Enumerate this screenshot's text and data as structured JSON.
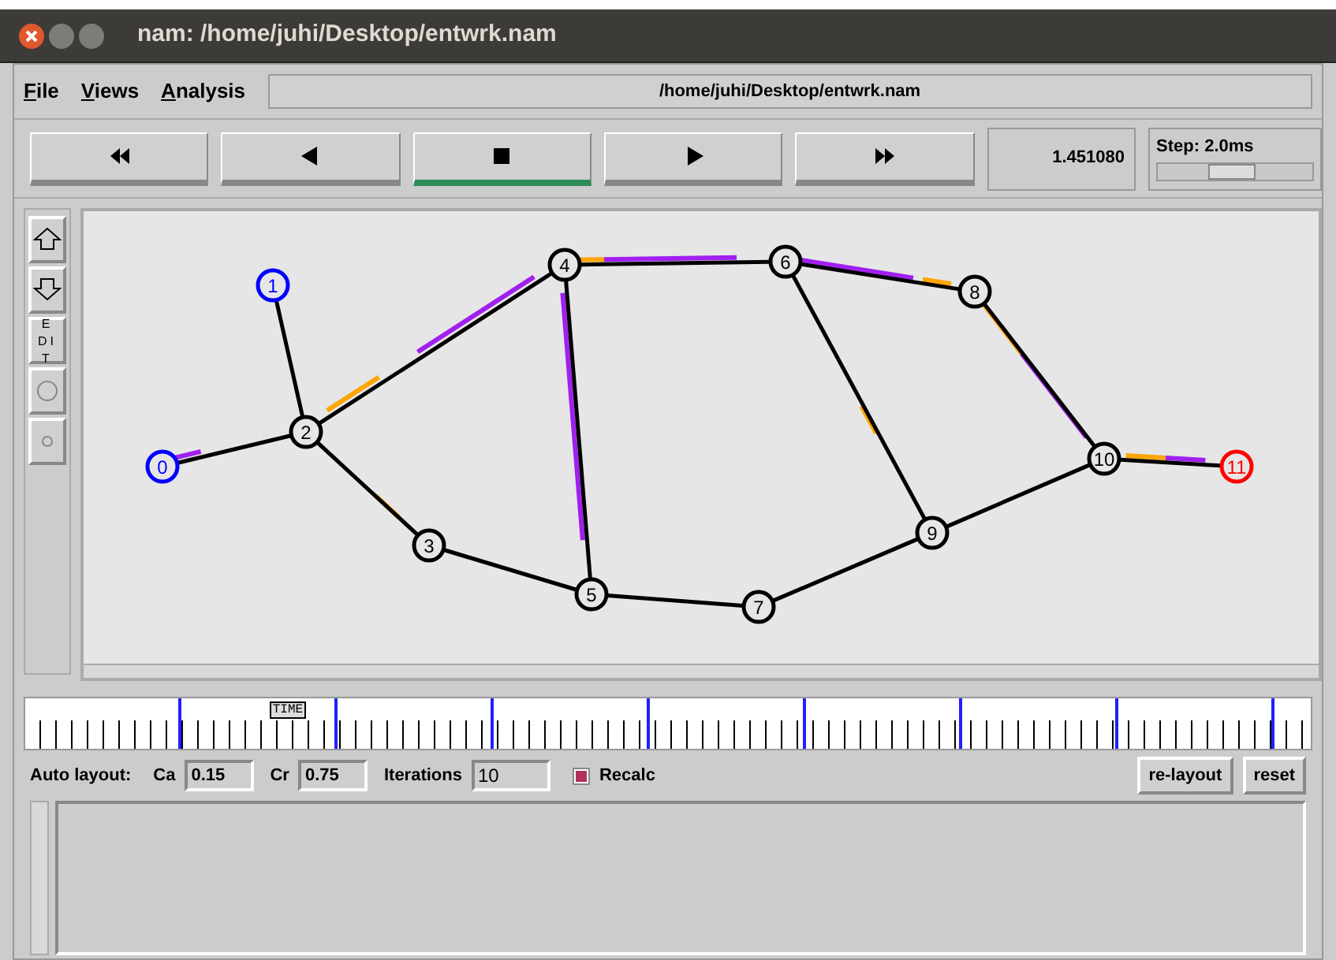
{
  "window": {
    "title": "nam: /home/juhi/Desktop/entwrk.nam"
  },
  "menu": [
    {
      "label": "File"
    },
    {
      "label": "Views"
    },
    {
      "label": "Analysis"
    }
  ],
  "file_path": "/home/juhi/Desktop/entwrk.nam",
  "playback_buttons": [
    {
      "kind": "fast-rewind",
      "selected": false
    },
    {
      "kind": "rewind",
      "selected": false
    },
    {
      "kind": "stop",
      "selected": true
    },
    {
      "kind": "play",
      "selected": false
    },
    {
      "kind": "fast-forward",
      "selected": false
    }
  ],
  "time": "1.451080",
  "step": {
    "label": "Step: 2.0ms",
    "level": 0.45
  },
  "tools": [
    {
      "kind": "zoom-in"
    },
    {
      "kind": "zoom-out"
    },
    {
      "kind": "edit",
      "label": "EDIT"
    },
    {
      "kind": "large-circle"
    },
    {
      "kind": "small-circle"
    }
  ],
  "nodes": [
    {
      "label": "0",
      "color": "#0000ff"
    },
    {
      "label": "1",
      "color": "#0000ff"
    },
    {
      "label": "2",
      "color": "#000000"
    },
    {
      "label": "3",
      "color": "#000000"
    },
    {
      "label": "4",
      "color": "#000000"
    },
    {
      "label": "5",
      "color": "#000000"
    },
    {
      "label": "6",
      "color": "#000000"
    },
    {
      "label": "7",
      "color": "#000000"
    },
    {
      "label": "8",
      "color": "#000000"
    },
    {
      "label": "9",
      "color": "#000000"
    },
    {
      "label": "10",
      "color": "#000000"
    },
    {
      "label": "11",
      "color": "#ff0000"
    }
  ],
  "timeline": {
    "marker": "TIME",
    "level": 0.19
  },
  "auto_layout": {
    "label": "Auto layout:",
    "fields": [
      {
        "label": "Ca",
        "value": "0.15"
      },
      {
        "label": "Cr",
        "value": "0.75"
      },
      {
        "label": "Iterations",
        "value": "10"
      }
    ],
    "recalc": {
      "label": "Recalc",
      "checked": true
    }
  },
  "buttons": [
    {
      "label": "re-layout"
    },
    {
      "label": "reset"
    }
  ]
}
